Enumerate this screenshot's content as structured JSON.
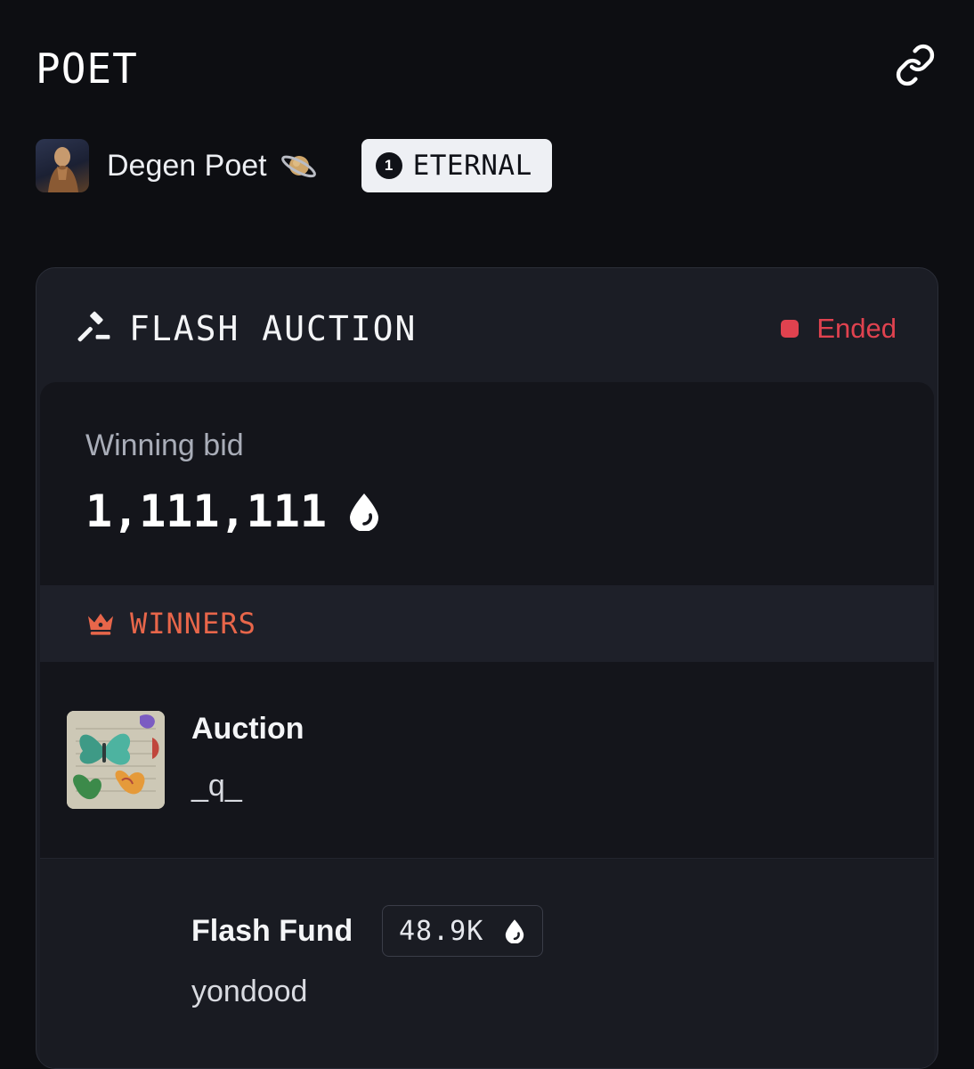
{
  "header": {
    "title": "POET",
    "link_icon": "link-icon"
  },
  "author": {
    "name": "Degen Poet",
    "emoji_icon": "ringed-planet-icon",
    "badge_number": "1",
    "badge_label": "ETERNAL"
  },
  "auction": {
    "title": "FLASH AUCTION",
    "title_icon": "gavel-icon",
    "status": "Ended",
    "status_color": "#e0424f",
    "winning_bid_label": "Winning bid",
    "winning_bid_value": "1,111,111",
    "currency_icon": "droplet-icon"
  },
  "winners": {
    "label": "WINNERS",
    "icon": "crown-icon",
    "accent": "#e8664a",
    "items": [
      {
        "title": "Auction",
        "user": "_q_"
      },
      {
        "title": "Flash Fund",
        "amount": "48.9K",
        "user": "yondood"
      }
    ]
  }
}
